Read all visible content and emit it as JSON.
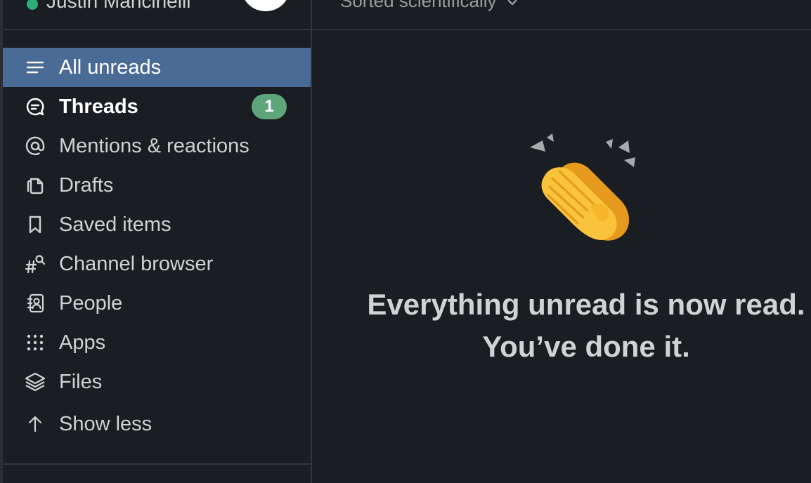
{
  "user": {
    "name": "Justin Mancinelli",
    "status": "active"
  },
  "header": {
    "sort_label": "Sorted scientifically"
  },
  "sidebar": {
    "items": [
      {
        "label": "All unreads",
        "icon": "lines-icon",
        "active": true
      },
      {
        "label": "Threads",
        "icon": "threads-icon",
        "badge": "1"
      },
      {
        "label": "Mentions & reactions",
        "icon": "at-icon"
      },
      {
        "label": "Drafts",
        "icon": "drafts-icon"
      },
      {
        "label": "Saved items",
        "icon": "bookmark-icon"
      },
      {
        "label": "Channel browser",
        "icon": "channel-browser-icon"
      },
      {
        "label": "People",
        "icon": "people-icon"
      },
      {
        "label": "Apps",
        "icon": "apps-grid-icon"
      },
      {
        "label": "Files",
        "icon": "layers-icon"
      }
    ],
    "show_less": "Show less"
  },
  "empty_state": {
    "line1": "Everything unread is now read.",
    "line2": "You’ve done it."
  },
  "colors": {
    "background": "#1a1d21",
    "active_item": "#4a6b96",
    "badge": "#5fa57b",
    "presence": "#2bac76"
  }
}
